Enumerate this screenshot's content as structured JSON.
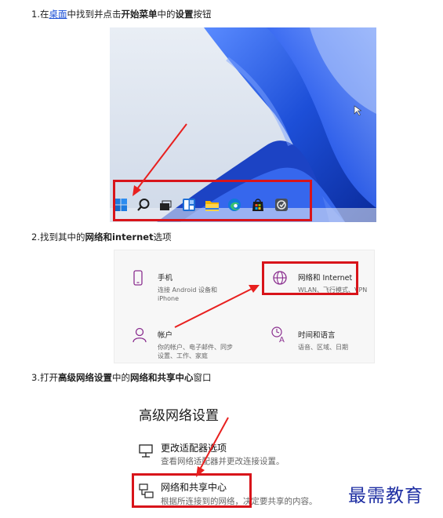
{
  "steps": {
    "s1": {
      "prefix": "1.在",
      "link": "桌面",
      "mid": "中找到并点击",
      "bold1": "开始菜单",
      "mid2": "中的",
      "bold2": "设置",
      "suffix": "按钮"
    },
    "s2": {
      "prefix": "2.找到其中的",
      "bold": "网络和internet",
      "suffix": "选项"
    },
    "s3": {
      "prefix": "3.打开",
      "bold1": "高级网络设置",
      "mid": "中的",
      "bold2": "网络和共享中心",
      "suffix": "窗口"
    }
  },
  "taskbar_icons": [
    "windows-start-icon",
    "search-icon",
    "task-view-icon",
    "widgets-icon",
    "file-explorer-icon",
    "edge-icon",
    "store-icon",
    "settings-tile-icon"
  ],
  "settings": {
    "phone": {
      "title": "手机",
      "sub1": "连接 Android 设备和",
      "sub2": "iPhone"
    },
    "network": {
      "title": "网络和 Internet",
      "sub1": "WLAN、飞行模式、VPN"
    },
    "accounts": {
      "title": "帐户",
      "sub1": "你的帐户、电子邮件、同步",
      "sub2": "设置、工作、家庭"
    },
    "time": {
      "title": "时间和语言",
      "sub1": "语音、区域、日期"
    }
  },
  "advanced": {
    "title": "高级网络设置",
    "adapter": {
      "title": "更改适配器选项",
      "sub": "查看网络适配器并更改连接设置。"
    },
    "sharing": {
      "title": "网络和共享中心",
      "sub": "根据所连接到的网络，决定要共享的内容。"
    }
  },
  "watermark": "最需教育",
  "colors": {
    "highlight_red": "#d8141a",
    "link_blue": "#1a4fd6",
    "wallpaper_blue": "#1d4fd8"
  }
}
